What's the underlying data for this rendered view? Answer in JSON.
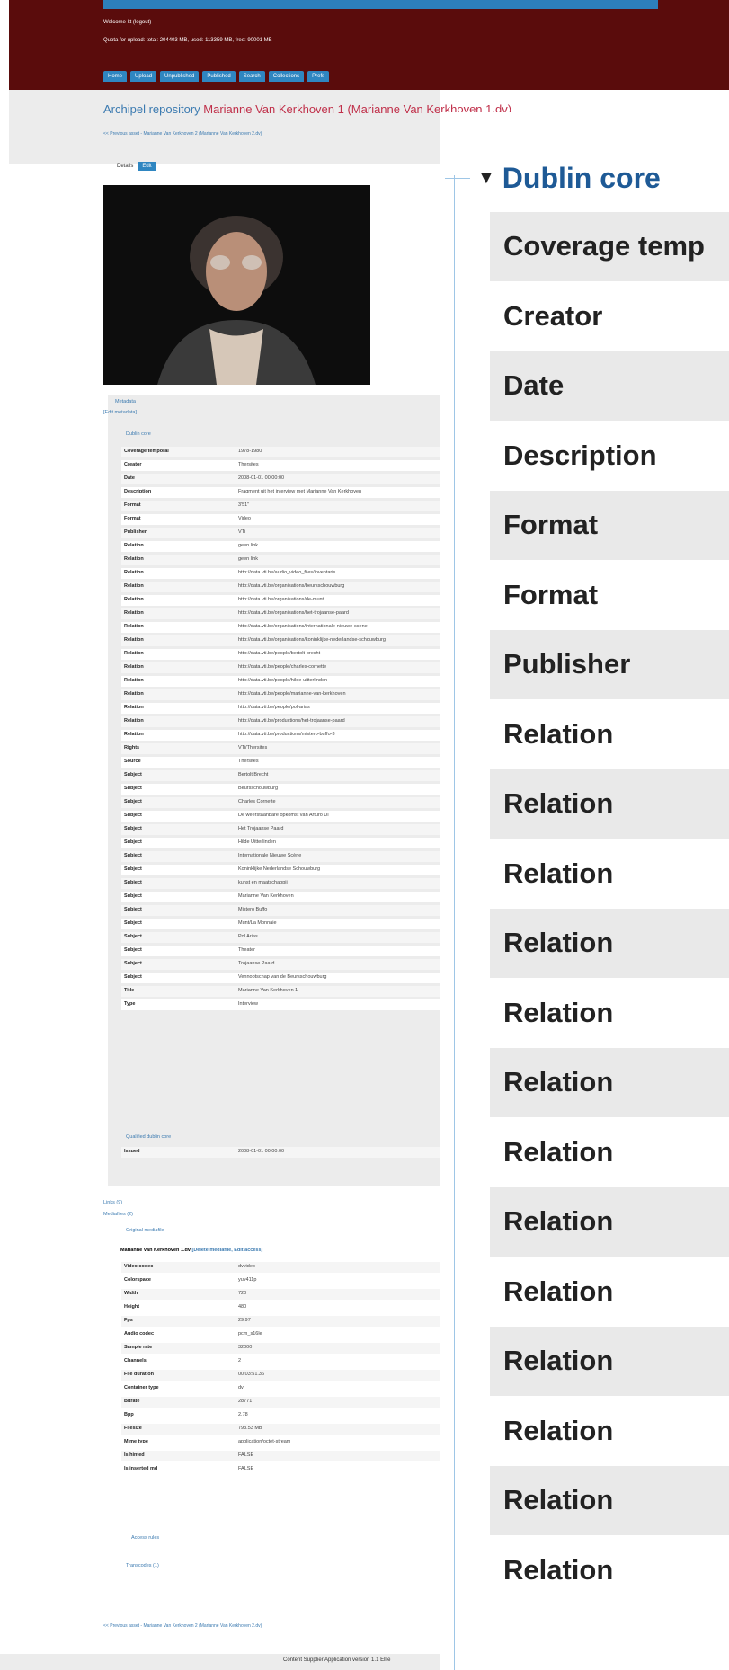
{
  "header": {
    "welcome": "Welcome kt (logout)",
    "quota": "Quota for upload: total: 204403 MB, used: 113359 MB, free: 90001 MB",
    "nav": [
      "Home",
      "Upload",
      "Unpublished",
      "Published",
      "Search",
      "Collections",
      "Prefs"
    ]
  },
  "breadcrumb": {
    "repo": "Archipel repository",
    "item": "Marianne Van Kerkhoven 1 (Marianne Van Kerkhoven 1.dv)",
    "prev": "<< Previous asset - Marianne Van Kerkhoven 2 (Marianne Van Kerkhoven 2.dv)"
  },
  "tabs": {
    "details": "Details",
    "edit": "Edit"
  },
  "meta": {
    "toggle": "Metadata",
    "edit_link": "[Edit metadata]",
    "dublin_title": "Dublin core",
    "rows": [
      [
        "Coverage temporal",
        "1978-1980"
      ],
      [
        "Creator",
        "Thersites"
      ],
      [
        "Date",
        "2008-01-01 00:00:00"
      ],
      [
        "Description",
        "Fragment uit het interview met Marianne Van Kerkhoven"
      ],
      [
        "Format",
        "3'51\""
      ],
      [
        "Format",
        "Video"
      ],
      [
        "Publisher",
        "VTi"
      ],
      [
        "Relation",
        "geen link"
      ],
      [
        "Relation",
        "geen link"
      ],
      [
        "Relation",
        "http://data.vti.be/audio_video_files/inventaris"
      ],
      [
        "Relation",
        "http://data.vti.be/organisations/beursschouwburg"
      ],
      [
        "Relation",
        "http://data.vti.be/organisations/de-munt"
      ],
      [
        "Relation",
        "http://data.vti.be/organisations/het-trojaanse-paard"
      ],
      [
        "Relation",
        "http://data.vti.be/organisations/internationale-nieuwe-scene"
      ],
      [
        "Relation",
        "http://data.vti.be/organisations/koninklijke-nederlandse-schouwburg"
      ],
      [
        "Relation",
        "http://data.vti.be/people/bertolt-brecht"
      ],
      [
        "Relation",
        "http://data.vti.be/people/charles-cornette"
      ],
      [
        "Relation",
        "http://data.vti.be/people/hilde-uitterlinden"
      ],
      [
        "Relation",
        "http://data.vti.be/people/marianne-van-kerkhoven"
      ],
      [
        "Relation",
        "http://data.vti.be/people/pol-arias"
      ],
      [
        "Relation",
        "http://data.vti.be/productions/het-trojaanse-paard"
      ],
      [
        "Relation",
        "http://data.vti.be/productions/mistero-buffo-3"
      ],
      [
        "Rights",
        "VTi/Thersites"
      ],
      [
        "Source",
        "Thersites"
      ],
      [
        "Subject",
        "Bertolt Brecht"
      ],
      [
        "Subject",
        "Beursschouwburg"
      ],
      [
        "Subject",
        "Charles Cornette"
      ],
      [
        "Subject",
        "De weerstaanbare opkomst van Arturo Ui"
      ],
      [
        "Subject",
        "Het Trojaanse Paard"
      ],
      [
        "Subject",
        "Hilde Uitterlinden"
      ],
      [
        "Subject",
        "Internationale Nieuwe Scène"
      ],
      [
        "Subject",
        "Koninklijke Nederlandse Schouwburg"
      ],
      [
        "Subject",
        "kunst en maatschappij"
      ],
      [
        "Subject",
        "Marianne Van Kerkhoven"
      ],
      [
        "Subject",
        "Mistero Buffo"
      ],
      [
        "Subject",
        "Munt/La Monnaie"
      ],
      [
        "Subject",
        "Pol Arias"
      ],
      [
        "Subject",
        "Theater"
      ],
      [
        "Subject",
        "Trojaanse Paard"
      ],
      [
        "Subject",
        "Vennootschap van de Beursschouwburg"
      ],
      [
        "Title",
        "Marianne Van Kerkhoven 1"
      ],
      [
        "Type",
        "Interview"
      ]
    ],
    "qualified_title": "Qualified dublin core",
    "qualified_rows": [
      [
        "Issued",
        "2008-01-01 00:00:00"
      ]
    ],
    "links": "Links (9)",
    "mediafiles": "Mediafiles (2)",
    "original": "Original mediafile",
    "mediafile_name": "Marianne Van Kerkhoven 1.dv",
    "mediafile_actions": "[Delete mediafile, Edit access]",
    "media_rows": [
      [
        "Video codec",
        "dvvideo"
      ],
      [
        "Colorspace",
        "yuv411p"
      ],
      [
        "Width",
        "720"
      ],
      [
        "Height",
        "480"
      ],
      [
        "Fps",
        "29.97"
      ],
      [
        "Audio codec",
        "pcm_s16le"
      ],
      [
        "Sample rate",
        "32000"
      ],
      [
        "Channels",
        "2"
      ],
      [
        "File duration",
        "00:03:51.36"
      ],
      [
        "Container type",
        "dv"
      ],
      [
        "Bitrate",
        "28771"
      ],
      [
        "Bpp",
        "2.78"
      ],
      [
        "Filesize",
        "793.53 MB"
      ],
      [
        "Mime type",
        "application/octet-stream"
      ],
      [
        "Is hinted",
        "FALSE"
      ],
      [
        "Is inserted md",
        "FALSE"
      ]
    ],
    "access_rules": "Access rules",
    "transcodes": "Transcodes (1)"
  },
  "footer": {
    "prev": "<< Previous asset - Marianne Van Kerkhoven 2 (Marianne Van Kerkhoven 2.dv)",
    "app": "Content Supplier Application version 1.1 Ellie"
  },
  "zoom": {
    "title": "Dublin core",
    "rows": [
      "Coverage temp",
      "Creator",
      "Date",
      "Description",
      "Format",
      "Format",
      "Publisher",
      "Relation",
      "Relation",
      "Relation",
      "Relation",
      "Relation",
      "Relation",
      "Relation",
      "Relation",
      "Relation",
      "Relation",
      "Relation",
      "Relation",
      "Relation"
    ]
  }
}
